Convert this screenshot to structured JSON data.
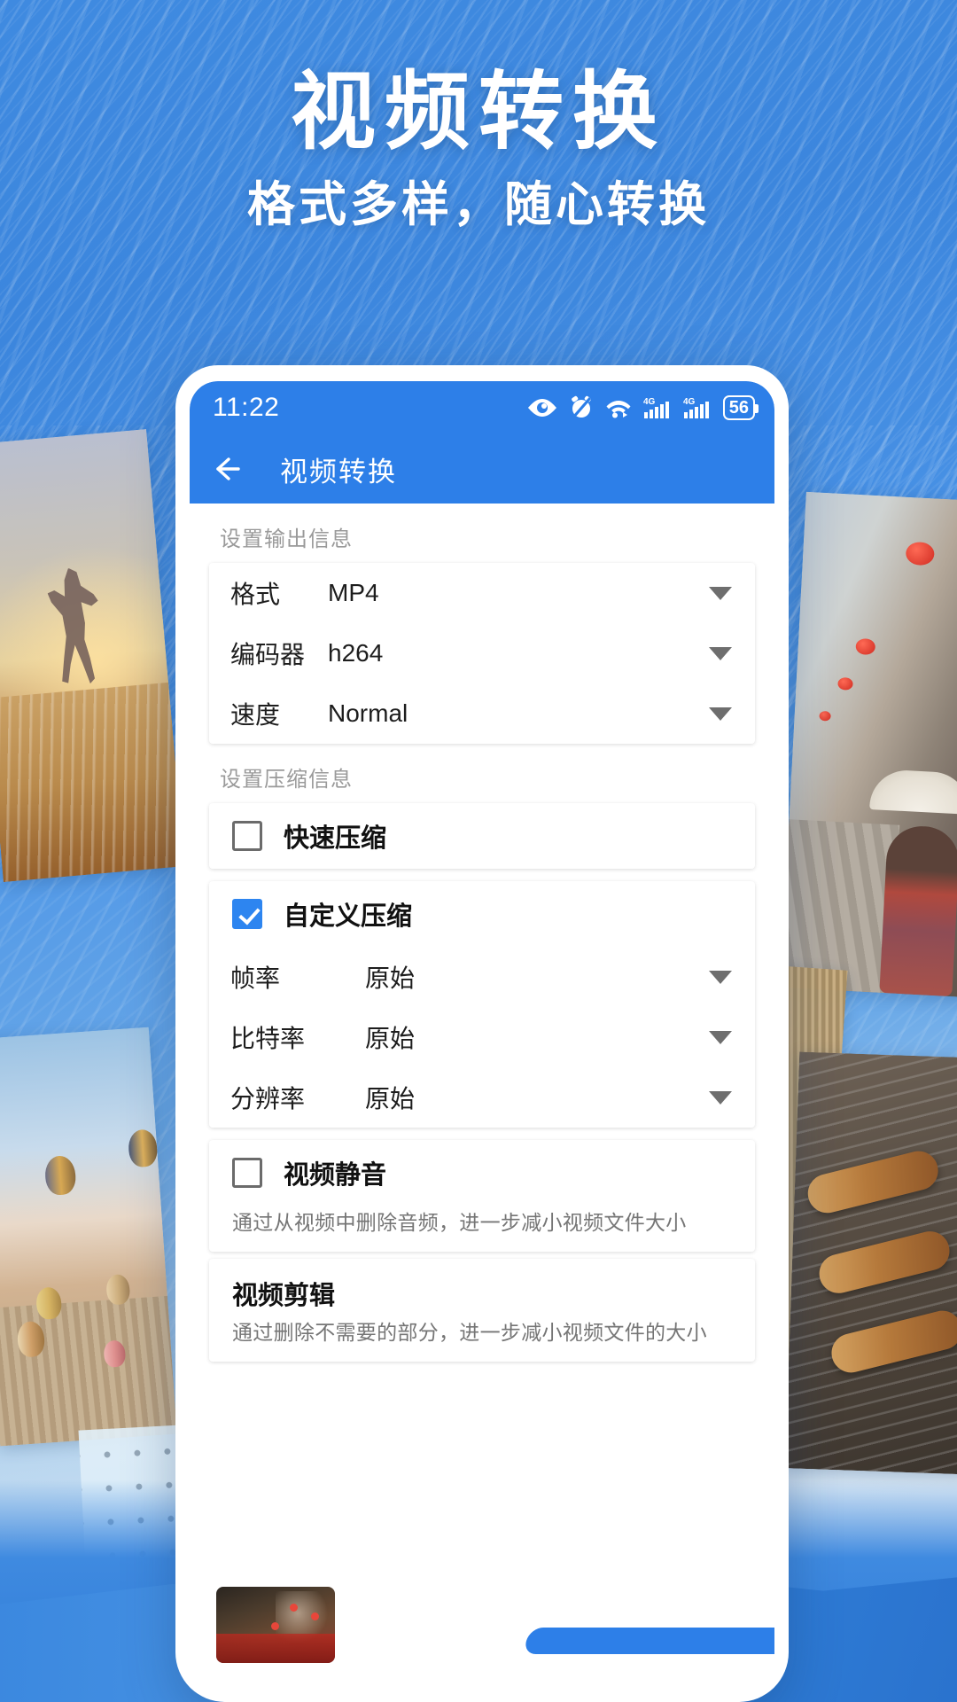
{
  "poster": {
    "title": "视频转换",
    "subtitle": "格式多样，随心转换"
  },
  "phone": {
    "statusbar": {
      "time": "11:22",
      "battery_level": "56",
      "icons": [
        "eye-icon",
        "alarm-muted-icon",
        "wifi-icon",
        "signal-4g-icon",
        "signal-4g-icon",
        "battery-icon"
      ]
    },
    "appbar": {
      "back_icon": "back-arrow-icon",
      "title": "视频转换"
    },
    "output_section": {
      "label": "设置输出信息",
      "rows": [
        {
          "label": "格式",
          "value": "MP4",
          "caret": "chevron-down-icon"
        },
        {
          "label": "编码器",
          "value": "h264",
          "caret": "chevron-down-icon"
        },
        {
          "label": "速度",
          "value": "Normal",
          "caret": "chevron-down-icon"
        }
      ]
    },
    "compress_section": {
      "label": "设置压缩信息",
      "fast": {
        "label": "快速压缩",
        "checked": false
      },
      "custom": {
        "label": "自定义压缩",
        "checked": true
      },
      "custom_rows": [
        {
          "label": "帧率",
          "value": "原始",
          "caret": "chevron-down-icon"
        },
        {
          "label": "比特率",
          "value": "原始",
          "caret": "chevron-down-icon"
        },
        {
          "label": "分辨率",
          "value": "原始",
          "caret": "chevron-down-icon"
        }
      ]
    },
    "mute": {
      "label": "视频静音",
      "checked": false,
      "description": "通过从视频中删除音频，进一步减小视频文件大小"
    },
    "trim": {
      "label": "视频剪辑",
      "description": "通过删除不需要的部分，进一步减小视频文件的大小"
    }
  },
  "colors": {
    "accent": "#2d7fe8",
    "checkbox_on": "#2d85f0",
    "section_label": "#9a9a9a",
    "description": "#757575"
  }
}
